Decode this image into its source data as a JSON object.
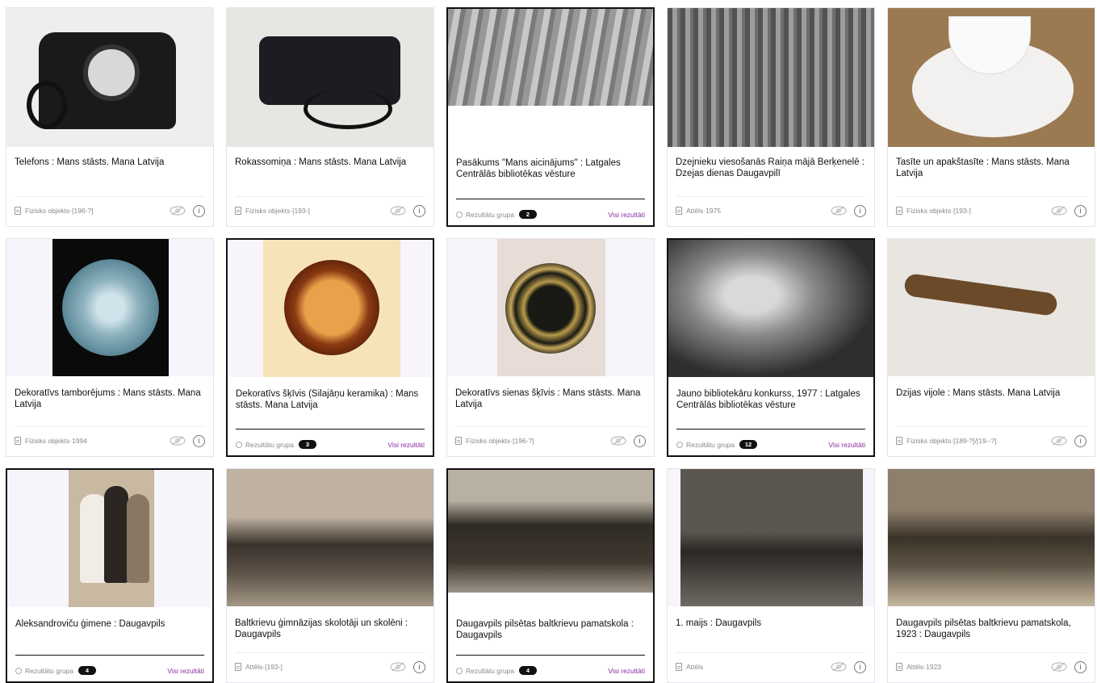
{
  "cards": [
    {
      "title": "Telefons : Mans stāsts. Mana Latvija",
      "type": "Fizisks objekts",
      "date": "[196-?]"
    },
    {
      "title": "Rokassomiņa : Mans stāsts. Mana Latvija",
      "type": "Fizisks objekts",
      "date": "[193-]"
    },
    {
      "title": "Pasākums \"Mans aicinājums\" : Latgales Centrālās bibliotēkas vēsture",
      "group_label": "Rezultātu grupa",
      "count": "2",
      "all_label": "Visi rezultāti"
    },
    {
      "title": "Dzejnieku viesošanās Raiņa mājā Berķenelē : Dzejas dienas Daugavpilī",
      "type": "Attēls",
      "date": "1975"
    },
    {
      "title": "Tasīte un apakštasīte : Mans stāsts. Mana Latvija",
      "type": "Fizisks objekts",
      "date": "[193-]"
    },
    {
      "title": "Dekoratīvs tamborējums : Mans stāsts. Mana Latvija",
      "type": "Fizisks objekts",
      "date": "1994"
    },
    {
      "title": "Dekoratīvs šķīvis (Silajāņu keramika) : Mans stāsts. Mana Latvija",
      "group_label": "Rezultātu grupa",
      "count": "3",
      "all_label": "Visi rezultāti"
    },
    {
      "title": "Dekoratīvs sienas šķīvis : Mans stāsts. Mana Latvija",
      "type": "Fizisks objekts",
      "date": "[196-?]"
    },
    {
      "title": "Jauno bibliotekāru konkurss, 1977 : Latgales Centrālās bibliotēkas vēsture",
      "group_label": "Rezultātu grupa",
      "count": "12",
      "all_label": "Visi rezultāti"
    },
    {
      "title": "Dzijas vijole : Mans stāsts. Mana Latvija",
      "type": "Fizisks objekts",
      "date": "[189-?]/[19--?]"
    },
    {
      "title": "Aleksandroviču ģimene : Daugavpils",
      "group_label": "Rezultātu grupa",
      "count": "4",
      "all_label": "Visi rezultāti"
    },
    {
      "title": "Baltkrievu ģimnāzijas skolotāji un skolēni : Daugavpils",
      "type": "Attēls",
      "date": "[193-]"
    },
    {
      "title": "Daugavpils pilsētas baltkrievu pamatskola : Daugavpils",
      "group_label": "Rezultātu grupa",
      "count": "4",
      "all_label": "Visi rezultāti"
    },
    {
      "title": "1. maijs : Daugavpils",
      "type": "Attēls",
      "date": ""
    },
    {
      "title": "Daugavpils pilsētas baltkrievu pamatskola, 1923 : Daugavpils",
      "type": "Attēls",
      "date": "1923"
    }
  ],
  "meta_sep": " · ",
  "info_glyph": "i",
  "colors": {
    "link": "#8a2aa3",
    "badge": "#111111",
    "border": "#e7e4ea",
    "thumb_bg": "#f8f4fb"
  }
}
